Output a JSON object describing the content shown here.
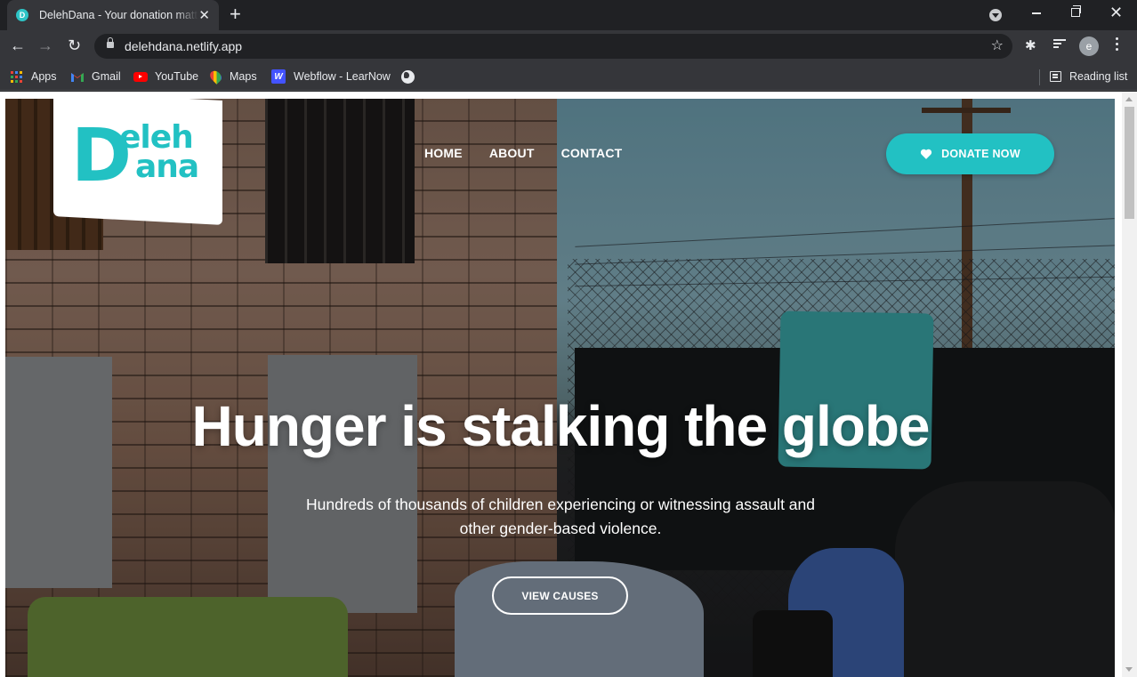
{
  "browser": {
    "tab_title": "DelehDana - Your donation matters",
    "tab_favicon": "D",
    "url": "delehdana.netlify.app",
    "avatar_letter": "e",
    "bookmarks": [
      {
        "label": "Apps",
        "icon": "apps-grid-icon"
      },
      {
        "label": "Gmail",
        "icon": "gmail-icon"
      },
      {
        "label": "YouTube",
        "icon": "youtube-icon"
      },
      {
        "label": "Maps",
        "icon": "maps-icon"
      },
      {
        "label": "Webflow - LearNow",
        "icon": "webflow-icon"
      },
      {
        "label": "",
        "icon": "globe-icon"
      }
    ],
    "reading_list": "Reading list"
  },
  "site": {
    "logo": {
      "letter": "D",
      "line1": "eleh",
      "line2": "ana"
    },
    "nav": [
      {
        "label": "HOME"
      },
      {
        "label": "ABOUT"
      },
      {
        "label": "CONTACT"
      }
    ],
    "donate_label": "DONATE NOW",
    "hero": {
      "title": "Hunger is stalking the globe",
      "subtitle": "Hundreds of thousands of children experiencing or witnessing assault and other gender-based violence.",
      "cta": "VIEW CAUSES"
    }
  },
  "colors": {
    "brand": "#22c1c3",
    "chrome_dark": "#202124",
    "chrome_toolbar": "#35363a"
  }
}
